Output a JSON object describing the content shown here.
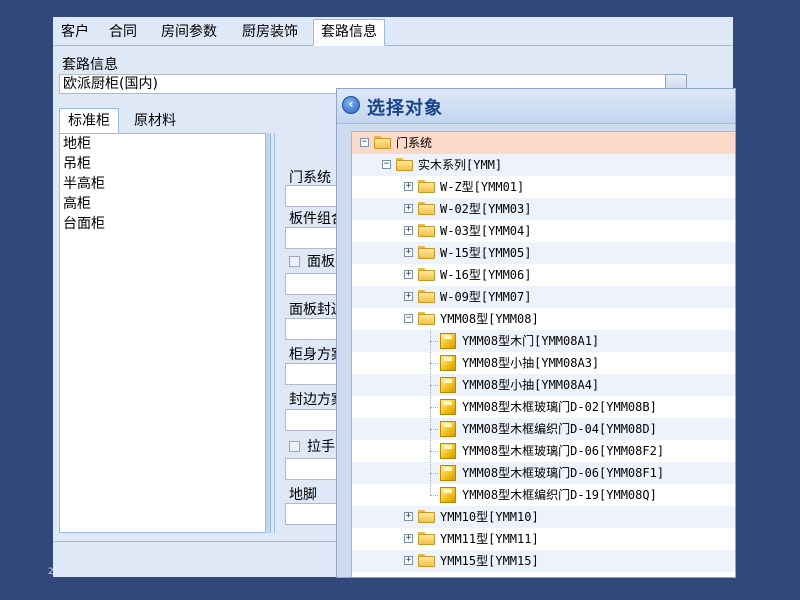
{
  "main_tabs": [
    {
      "label": "客户",
      "active": false
    },
    {
      "label": "合同",
      "active": false
    },
    {
      "label": "房间参数",
      "active": false
    },
    {
      "label": "厨房装饰",
      "active": false
    },
    {
      "label": "套路信息",
      "active": true
    }
  ],
  "route": {
    "label": "套路信息",
    "value": "欧派厨柜(国内)"
  },
  "sub_tabs": [
    {
      "label": "标准柜",
      "active": true
    },
    {
      "label": "原材料",
      "active": false
    }
  ],
  "cabinet_list": [
    "地柜",
    "吊柜",
    "半高柜",
    "高柜",
    "台面柜"
  ],
  "form_labels": {
    "door_system": "门系统",
    "panel_combo": "板件组合",
    "panel_check": "面板",
    "panel_edge": "面板封边",
    "body_scheme": "柜身方案",
    "edge_scheme": "封边方案",
    "handle_check": "拉手",
    "foot": "地脚"
  },
  "slide_number": "2",
  "dialog": {
    "title": "选择对象",
    "icon": "back-arrow-icon",
    "tree": [
      {
        "text": "门系统",
        "level": 0,
        "kind": "folder",
        "toggle": "-",
        "selected": true
      },
      {
        "text": "实木系列[YMM]",
        "level": 1,
        "kind": "folder",
        "toggle": "-"
      },
      {
        "text": "W-Z型[YMM01]",
        "level": 2,
        "kind": "folder",
        "toggle": "+"
      },
      {
        "text": "W-02型[YMM03]",
        "level": 2,
        "kind": "folder",
        "toggle": "+"
      },
      {
        "text": "W-03型[YMM04]",
        "level": 2,
        "kind": "folder",
        "toggle": "+"
      },
      {
        "text": "W-15型[YMM05]",
        "level": 2,
        "kind": "folder",
        "toggle": "+"
      },
      {
        "text": "W-16型[YMM06]",
        "level": 2,
        "kind": "folder",
        "toggle": "+"
      },
      {
        "text": "W-09型[YMM07]",
        "level": 2,
        "kind": "folder",
        "toggle": "+"
      },
      {
        "text": "YMM08型[YMM08]",
        "level": 2,
        "kind": "folder",
        "toggle": "-"
      },
      {
        "text": "YMM08型木门[YMM08A1]",
        "level": 3,
        "kind": "item"
      },
      {
        "text": "YMM08型小抽[YMM08A3]",
        "level": 3,
        "kind": "item"
      },
      {
        "text": "YMM08型小抽[YMM08A4]",
        "level": 3,
        "kind": "item"
      },
      {
        "text": "YMM08型木框玻璃门D-02[YMM08B]",
        "level": 3,
        "kind": "item"
      },
      {
        "text": "YMM08型木框编织门D-04[YMM08D]",
        "level": 3,
        "kind": "item"
      },
      {
        "text": "YMM08型木框玻璃门D-06[YMM08F2]",
        "level": 3,
        "kind": "item"
      },
      {
        "text": "YMM08型木框玻璃门D-06[YMM08F1]",
        "level": 3,
        "kind": "item"
      },
      {
        "text": "YMM08型木框编织门D-19[YMM08Q]",
        "level": 3,
        "kind": "item"
      },
      {
        "text": "YMM10型[YMM10]",
        "level": 2,
        "kind": "folder",
        "toggle": "+"
      },
      {
        "text": "YMM11型[YMM11]",
        "level": 2,
        "kind": "folder",
        "toggle": "+"
      },
      {
        "text": "YMM15型[YMM15]",
        "level": 2,
        "kind": "folder",
        "toggle": "+"
      }
    ]
  }
}
